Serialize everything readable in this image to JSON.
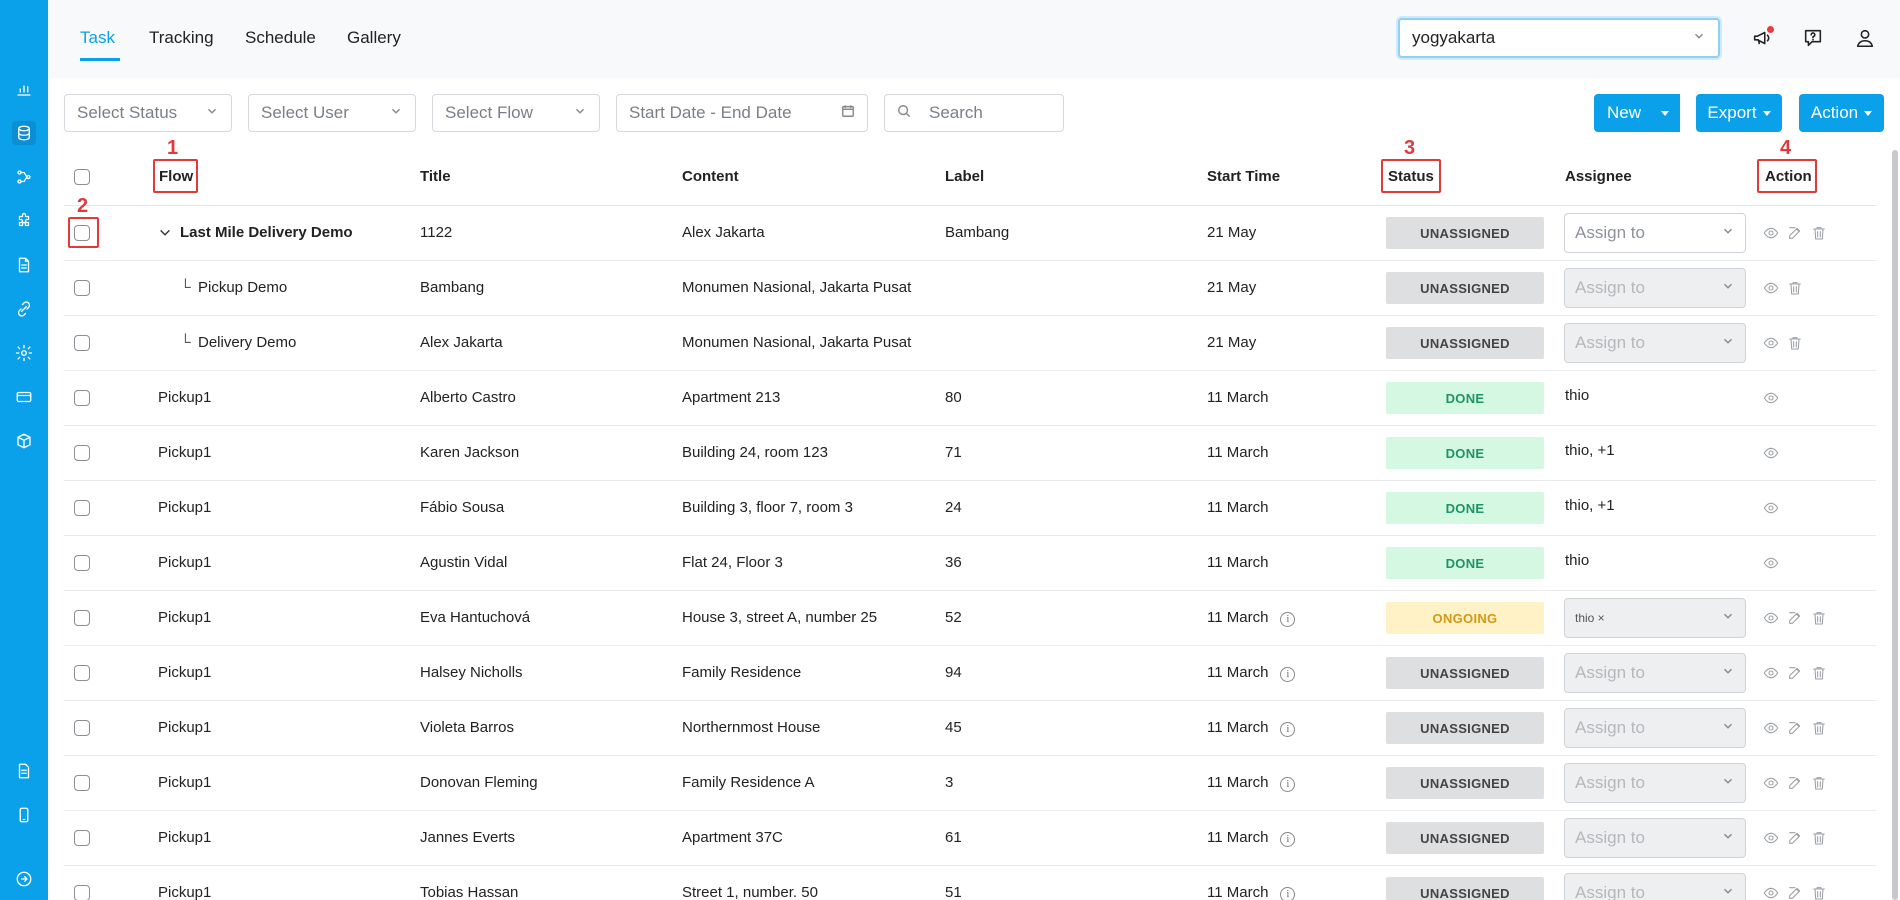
{
  "nav": {
    "tabs": [
      "Task",
      "Tracking",
      "Schedule",
      "Gallery"
    ],
    "location": "yogyakarta"
  },
  "filters": {
    "status": "Select Status",
    "user": "Select User",
    "flow": "Select Flow",
    "date": "Start Date - End Date",
    "search": "Search"
  },
  "buttons": {
    "new": "New",
    "export": "Export",
    "action": "Action"
  },
  "table": {
    "headers": {
      "flow": "Flow",
      "title": "Title",
      "content": "Content",
      "label": "Label",
      "start_time": "Start Time",
      "status": "Status",
      "assignee": "Assignee",
      "action": "Action"
    },
    "rows": [
      {
        "flow": "Last Mile Delivery Demo",
        "title": "1122",
        "content": "Alex Jakarta",
        "label": "Bambang",
        "start": "21 May",
        "status": "UNASSIGNED",
        "assignee": "Assign to"
      },
      {
        "flow": "Pickup Demo",
        "title": "Bambang",
        "content": "Monumen Nasional, Jakarta Pusat",
        "label": "",
        "start": "21 May",
        "status": "UNASSIGNED",
        "assignee": "Assign to"
      },
      {
        "flow": "Delivery Demo",
        "title": "Alex Jakarta",
        "content": "Monumen Nasional, Jakarta Pusat",
        "label": "",
        "start": "21 May",
        "status": "UNASSIGNED",
        "assignee": "Assign to"
      },
      {
        "flow": "Pickup1",
        "title": "Alberto Castro",
        "content": "Apartment 213",
        "label": "80",
        "start": "11 March",
        "status": "DONE",
        "assignee": "thio"
      },
      {
        "flow": "Pickup1",
        "title": "Karen Jackson",
        "content": "Building 24, room 123",
        "label": "71",
        "start": "11 March",
        "status": "DONE",
        "assignee": "thio, +1"
      },
      {
        "flow": "Pickup1",
        "title": "Fábio Sousa",
        "content": "Building 3, floor 7, room 3",
        "label": "24",
        "start": "11 March",
        "status": "DONE",
        "assignee": "thio, +1"
      },
      {
        "flow": "Pickup1",
        "title": "Agustin Vidal",
        "content": "Flat 24, Floor 3",
        "label": "36",
        "start": "11 March",
        "status": "DONE",
        "assignee": "thio"
      },
      {
        "flow": "Pickup1",
        "title": "Eva Hantuchová",
        "content": "House 3, street A, number 25",
        "label": "52",
        "start": "11 March",
        "status": "ONGOING",
        "assignee": "thio ×"
      },
      {
        "flow": "Pickup1",
        "title": "Halsey Nicholls",
        "content": "Family Residence",
        "label": "94",
        "start": "11 March",
        "status": "UNASSIGNED",
        "assignee": "Assign to"
      },
      {
        "flow": "Pickup1",
        "title": "Violeta Barros",
        "content": "Northernmost House",
        "label": "45",
        "start": "11 March",
        "status": "UNASSIGNED",
        "assignee": "Assign to"
      },
      {
        "flow": "Pickup1",
        "title": "Donovan Fleming",
        "content": "Family Residence A",
        "label": "3",
        "start": "11 March",
        "status": "UNASSIGNED",
        "assignee": "Assign to"
      },
      {
        "flow": "Pickup1",
        "title": "Jannes Everts",
        "content": "Apartment 37C",
        "label": "61",
        "start": "11 March",
        "status": "UNASSIGNED",
        "assignee": "Assign to"
      },
      {
        "flow": "Pickup1",
        "title": "Tobias Hassan",
        "content": "Street 1, number. 50",
        "label": "51",
        "start": "11 March",
        "status": "UNASSIGNED",
        "assignee": "Assign to"
      }
    ]
  },
  "annotations": [
    "1",
    "2",
    "3",
    "4"
  ],
  "colors": {
    "accent": "#0aa0ea",
    "done": "#1f9460",
    "ongoing": "#d59815",
    "annotation": "#e03b3b"
  }
}
